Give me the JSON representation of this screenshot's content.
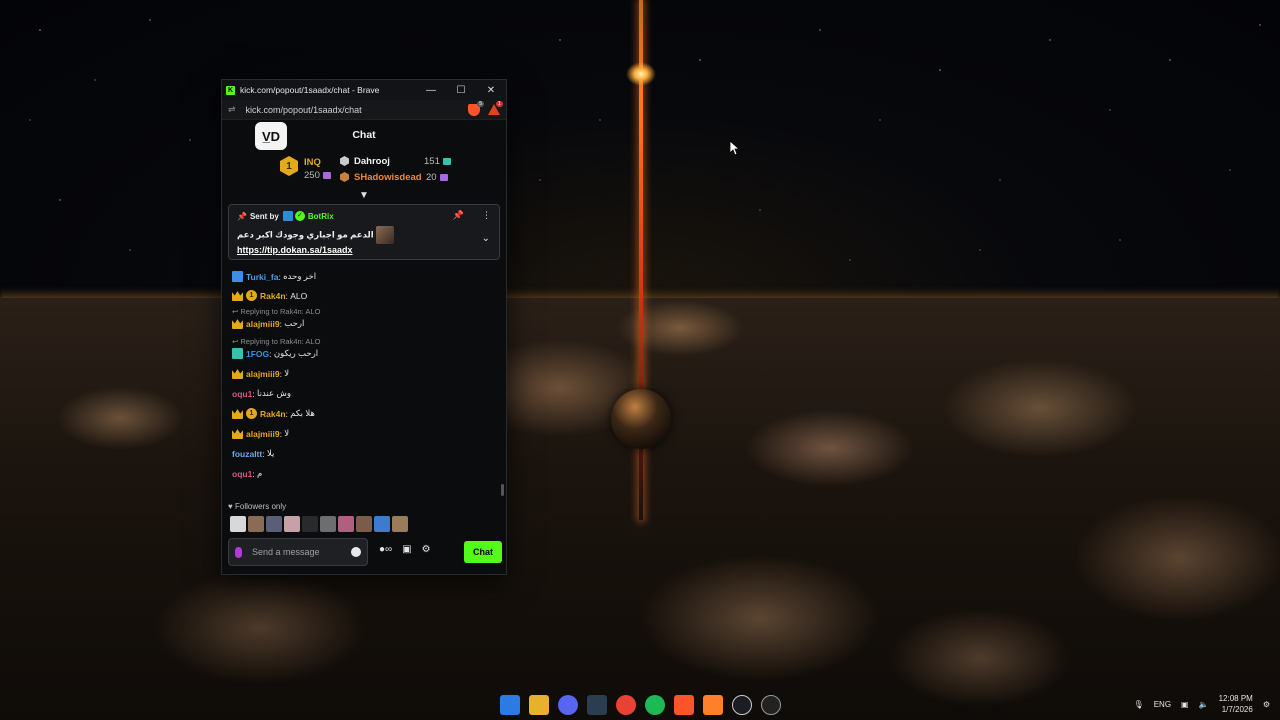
{
  "window": {
    "title": "kick.com/popout/1saadx/chat - Brave",
    "url": "kick.com/popout/1saadx/chat",
    "brave_shield_badge": "5",
    "brave_rewards_badge": "1"
  },
  "chat": {
    "header": "Chat",
    "channel_avatar_text": "V̲D",
    "leaderboard": {
      "first": {
        "rank": "1",
        "name": "INQ",
        "count": "250"
      },
      "second": {
        "name": "Dahrooj",
        "count": "151"
      },
      "third": {
        "name": "SHadowisdead",
        "count": "20"
      }
    },
    "pinned": {
      "sent_by_label": "Sent by",
      "sender": "BotRix",
      "message": "الدعم مو اجباري وجودك اكبر دعم",
      "link": "https://tip.dokan.sa/1saadx"
    },
    "messages": [
      {
        "user": "Turki_fa",
        "text": "اخر وحده",
        "color": "#4a9fe8"
      },
      {
        "user": "Rak4n",
        "text": "ALO",
        "color": "#e2a91b"
      },
      {
        "reply": "Replying to Rak4n: ALO",
        "user": "alajmiii9",
        "text": "ارحب",
        "color": "#e2a91b"
      },
      {
        "reply": "Replying to Rak4n: ALO",
        "user": "1FOG",
        "text": "ارحب ريكون",
        "color": "#3d8ee8"
      },
      {
        "user": "alajmiii9",
        "text": "لا",
        "color": "#e2a91b"
      },
      {
        "user": "oqu1",
        "text": "وش عندنا",
        "color": "#e0508a"
      },
      {
        "user": "Rak4n",
        "text": "هلا بكم",
        "color": "#e2a91b"
      },
      {
        "user": "alajmiii9",
        "text": "لا",
        "color": "#e2a91b"
      },
      {
        "user": "fouzaltt",
        "text": "يلا",
        "color": "#6fa7e8"
      },
      {
        "user": "oqu1",
        "text": "م",
        "color": "#e0508a"
      }
    ],
    "followers_only": "Followers only",
    "composer_placeholder": "Send a message",
    "send_label": "Chat"
  },
  "taskbar": {
    "language": "ENG",
    "time": "12:08 PM",
    "date": "1/7/2026"
  },
  "colors": {
    "kick_green": "#53fc18",
    "gold": "#e2a91b",
    "purple_gift": "#a86ad8",
    "teal_gift": "#35c3b0"
  }
}
